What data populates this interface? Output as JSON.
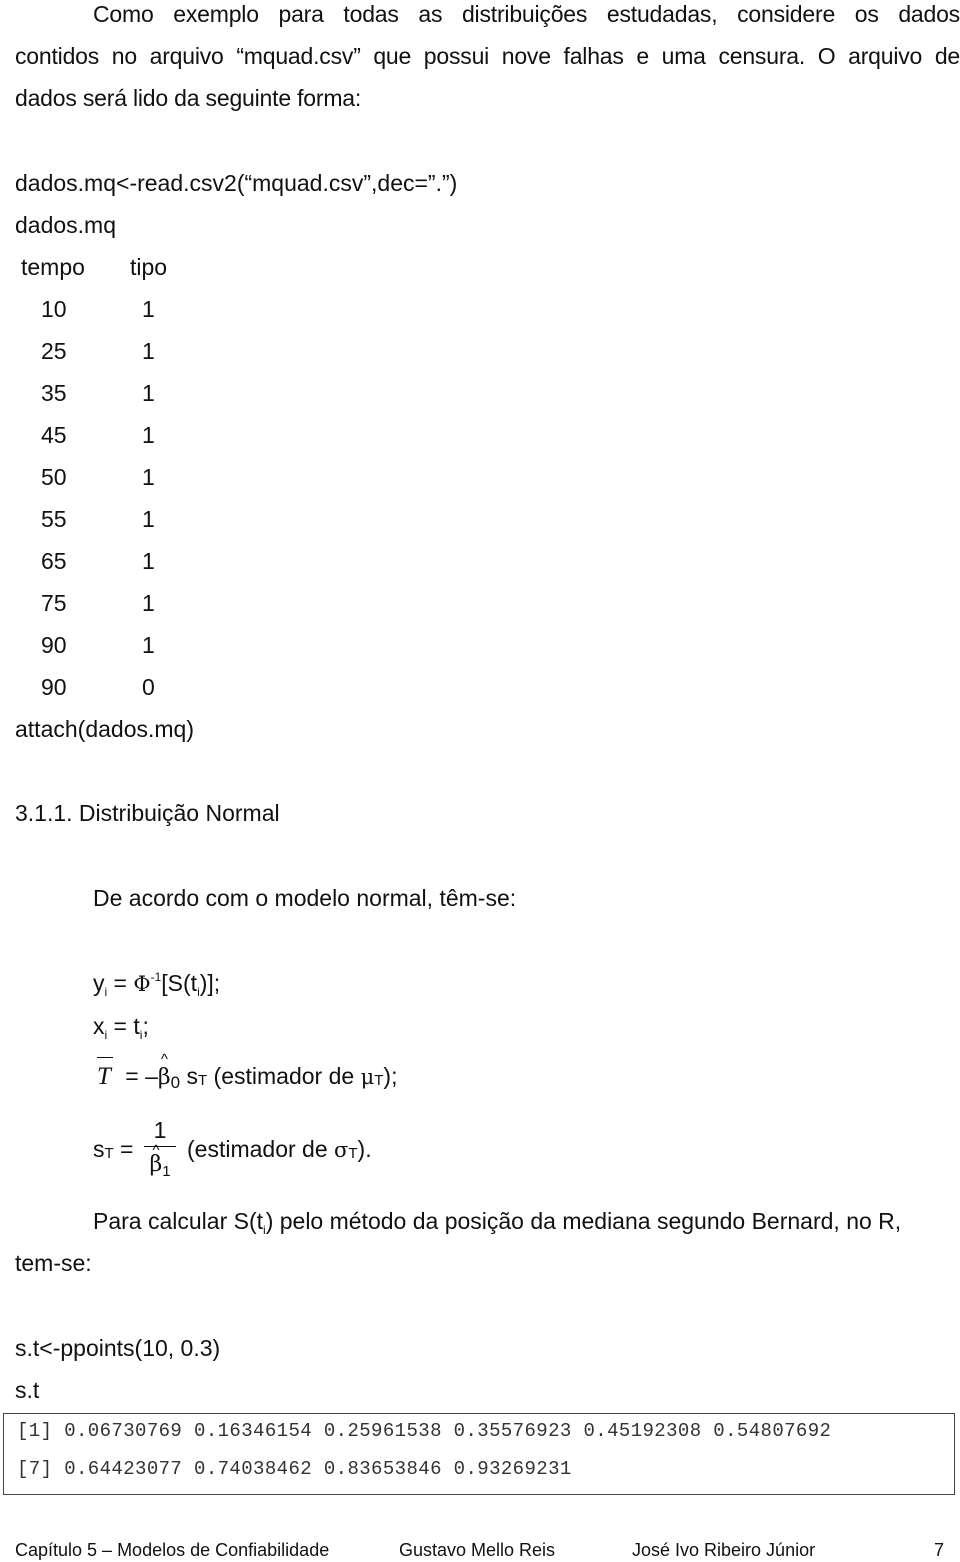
{
  "intro_paragraph": {
    "line1": "Como exemplo para todas as distribuições estudadas, considere os dados",
    "line2": "contidos no arquivo “mquad.csv” que possui nove falhas e uma censura. O arquivo de",
    "line3": "dados será lido da seguinte forma:"
  },
  "code_read": "dados.mq<-read.csv2(“mquad.csv”,dec=”.”)",
  "code_print": "dados.mq",
  "data_table": {
    "headers": [
      "tempo",
      "tipo"
    ],
    "rows": [
      [
        "10",
        "1"
      ],
      [
        "25",
        "1"
      ],
      [
        "35",
        "1"
      ],
      [
        "45",
        "1"
      ],
      [
        "50",
        "1"
      ],
      [
        "55",
        "1"
      ],
      [
        "65",
        "1"
      ],
      [
        "75",
        "1"
      ],
      [
        "90",
        "1"
      ],
      [
        "90",
        "0"
      ]
    ]
  },
  "code_attach": "attach(dados.mq)",
  "section_heading": "3.1.1. Distribuição Normal",
  "model_intro": "De acordo com o modelo normal, têm-se:",
  "equations": {
    "y": {
      "lhs": "y",
      "lhs_sub": "i",
      "eq": " = ",
      "phi": "Φ",
      "phi_sup": "-1",
      "rhs_a": "[S(t",
      "rhs_sub": "i",
      "rhs_b": ")];"
    },
    "x": {
      "lhs": "x",
      "lhs_sub": "i",
      "eq": " = t",
      "rhs_sub": "i",
      "rhs_b": ";"
    },
    "tbar": {
      "lhs": "T",
      "eq": " = –",
      "beta": "β",
      "beta_sub": "0",
      "s": " s",
      "s_sub": "T",
      "desc_a": " (estimador de ",
      "mu": "μ",
      "mu_sub": "T",
      "desc_b": ");"
    },
    "sT": {
      "lhs": "s",
      "lhs_sub": "T",
      "eq": " = ",
      "numerator": "1",
      "beta": "β",
      "beta_sub": "1",
      "desc_a": "(estimador de ",
      "sigma": "σ",
      "sigma_sub": "T",
      "desc_b": ")."
    }
  },
  "bernard_paragraph": {
    "line1_a": "Para calcular S(t",
    "line1_sub": "i",
    "line1_b": ") pelo método da posição da mediana segundo Bernard, no R,",
    "line2": "tem-se:"
  },
  "code_ppoints": "s.t<-ppoints(10, 0.3)",
  "code_st": "s.t",
  "r_output": {
    "line1": "[1] 0.06730769 0.16346154 0.25961538 0.35576923 0.45192308 0.54807692",
    "line2": "[7] 0.64423077 0.74038462 0.83653846 0.93269231"
  },
  "footer": {
    "chapter": "Capítulo 5 – Modelos de Confiabilidade",
    "author1": "Gustavo Mello Reis",
    "author2": "José Ivo Ribeiro Júnior",
    "page_number": "7"
  }
}
